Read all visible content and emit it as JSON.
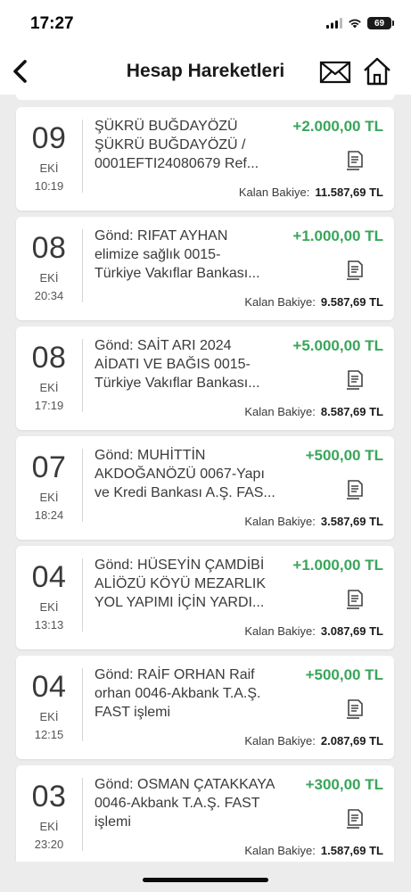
{
  "status": {
    "time": "17:27",
    "battery": "69"
  },
  "header": {
    "title": "Hesap Hareketleri"
  },
  "transactions": [
    {
      "day": "09",
      "month": "EKİ",
      "time": "10:19",
      "lines": [
        "ŞÜKRÜ BUĞDAYÖZÜ",
        "ŞÜKRÜ BUĞDAYÖZÜ /",
        "0001EFTI24080679 Ref..."
      ],
      "amount": "+2.000,00 TL",
      "balance_label": "Kalan Bakiye:",
      "balance": "11.587,69 TL"
    },
    {
      "day": "08",
      "month": "EKİ",
      "time": "20:34",
      "lines": [
        "Gönd: RIFAT AYHAN",
        "elimize sağlık 0015-",
        "Türkiye Vakıflar Bankası..."
      ],
      "amount": "+1.000,00 TL",
      "balance_label": "Kalan Bakiye:",
      "balance": "9.587,69 TL"
    },
    {
      "day": "08",
      "month": "EKİ",
      "time": "17:19",
      "lines": [
        "Gönd: SAİT ARI 2024",
        "AİDATI VE BAĞIS 0015-",
        "Türkiye Vakıflar Bankası..."
      ],
      "amount": "+5.000,00 TL",
      "balance_label": "Kalan Bakiye:",
      "balance": "8.587,69 TL"
    },
    {
      "day": "07",
      "month": "EKİ",
      "time": "18:24",
      "lines": [
        "Gönd: MUHİTTİN",
        "AKDOĞANÖZÜ 0067-Yapı",
        "ve Kredi Bankası A.Ş. FAS..."
      ],
      "amount": "+500,00 TL",
      "balance_label": "Kalan Bakiye:",
      "balance": "3.587,69 TL"
    },
    {
      "day": "04",
      "month": "EKİ",
      "time": "13:13",
      "lines": [
        "Gönd: HÜSEYİN ÇAMDİBİ",
        "ALİÖZÜ KÖYÜ MEZARLIK",
        "YOL YAPIMI İÇİN YARDI..."
      ],
      "amount": "+1.000,00 TL",
      "balance_label": "Kalan Bakiye:",
      "balance": "3.087,69 TL"
    },
    {
      "day": "04",
      "month": "EKİ",
      "time": "12:15",
      "lines": [
        "Gönd: RAİF ORHAN Raif",
        "orhan 0046-Akbank T.A.Ş.",
        "FAST işlemi"
      ],
      "amount": "+500,00 TL",
      "balance_label": "Kalan Bakiye:",
      "balance": "2.087,69 TL"
    },
    {
      "day": "03",
      "month": "EKİ",
      "time": "23:20",
      "lines": [
        "Gönd: OSMAN ÇATAKKAYA",
        "0046-Akbank T.A.Ş. FAST",
        "işlemi"
      ],
      "amount": "+300,00 TL",
      "balance_label": "Kalan Bakiye:",
      "balance": "1.587,69 TL"
    }
  ],
  "colors": {
    "credit": "#3aa55a",
    "background": "#ececec",
    "card": "#ffffff"
  },
  "icons": [
    "back-chevron-icon",
    "mail-icon",
    "home-icon",
    "receipt-icon",
    "signal-icon",
    "wifi-icon",
    "battery-icon"
  ]
}
